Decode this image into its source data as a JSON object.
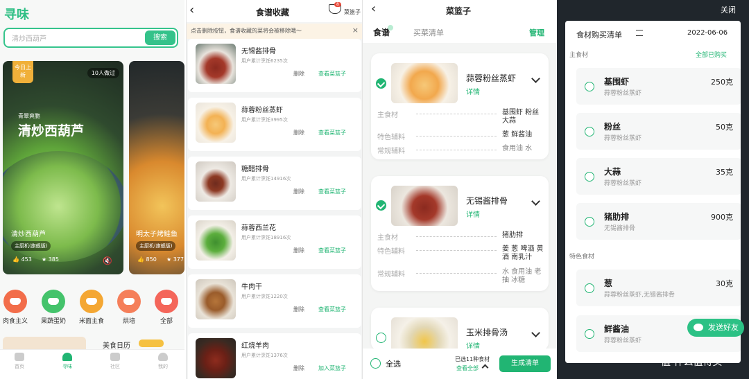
{
  "screen1": {
    "logo": "寻味",
    "search_placeholder": "清炒西葫芦",
    "search_button": "搜索",
    "card1": {
      "tag": "今日上新",
      "viewed": "10人做过",
      "subtitle": "青翠爽脆",
      "title": "清炒西葫芦",
      "caption": "清炒西葫芦",
      "machine": "主厨机(旗舰版)",
      "likes": "453",
      "favs": "385",
      "mute_icon": "mute-icon"
    },
    "card2": {
      "caption": "明太子烤鲑鱼",
      "machine": "主厨机(旗舰版)",
      "likes": "850",
      "favs": "377"
    },
    "categories": [
      {
        "label": "肉食主义",
        "color": "#f26d4a"
      },
      {
        "label": "果蔬蛋奶",
        "color": "#44c36b"
      },
      {
        "label": "米面主食",
        "color": "#f4a733"
      },
      {
        "label": "烘培",
        "color": "#f57f5a"
      },
      {
        "label": "全部",
        "color": "#f4665a"
      }
    ],
    "promo_text": "美食日历",
    "promo_badge": "",
    "tabs": [
      "首页",
      "寻味",
      "社区",
      "我的"
    ]
  },
  "screen2": {
    "title": "食谱收藏",
    "basket_label": "菜篮子",
    "basket_count": "8",
    "notice": "点击删除按钮，食谱收藏的菜将会被移除哦～",
    "close": "×",
    "delete_label": "删除",
    "recipes": [
      {
        "name": "无锡酱排骨",
        "count": "用户累计烹饪6235次",
        "action": "查看菜篮子"
      },
      {
        "name": "蒜蓉粉丝蒸虾",
        "count": "用户累计烹饪3995次",
        "action": "查看菜篮子"
      },
      {
        "name": "糖醋排骨",
        "count": "用户累计烹饪14916次",
        "action": "查看菜篮子"
      },
      {
        "name": "蒜蓉西兰花",
        "count": "用户累计烹饪18916次",
        "action": "查看菜篮子"
      },
      {
        "name": "牛肉干",
        "count": "用户累计烹饪1220次",
        "action": "查看菜篮子"
      },
      {
        "name": "红烧羊肉",
        "count": "用户累计烹饪1376次",
        "action": "加入菜篮子"
      }
    ]
  },
  "screen3": {
    "title": "菜篮子",
    "tab_recipes": "食谱",
    "tab_list": "买菜清单",
    "manage": "管理",
    "details_label": "详情",
    "labels": {
      "main": "主食材",
      "special": "特色辅料",
      "common": "常规辅料"
    },
    "recipes": [
      {
        "name": "蒜蓉粉丝蒸虾",
        "main": "基围虾 粉丝 大蒜",
        "special": "葱 鲜酱油",
        "common": "食用油 水"
      },
      {
        "name": "无锡酱排骨",
        "main": "猪肋排",
        "special": "姜 葱 啤酒 黄酒 南乳汁",
        "common": "水 食用油 老抽 冰糖"
      },
      {
        "name": "玉米排骨汤",
        "main": "",
        "special": "",
        "common": ""
      }
    ],
    "select_all": "全选",
    "selected": "已选11种食材",
    "view_all": "查看全部",
    "generate": "生成清单"
  },
  "screen4": {
    "close": "关闭",
    "list_title": "食材购买清单",
    "date": "2022-06-06",
    "section_main": "主食材",
    "all_bought": "全部已购买",
    "section_special": "特色食材",
    "items": [
      {
        "name": "基围虾",
        "source": "蒜蓉粉丝蒸虾",
        "qty": "250克"
      },
      {
        "name": "粉丝",
        "source": "蒜蓉粉丝蒸虾",
        "qty": "50克"
      },
      {
        "name": "大蒜",
        "source": "蒜蓉粉丝蒸虾",
        "qty": "35克"
      },
      {
        "name": "猪肋排",
        "source": "无锡酱排骨",
        "qty": "900克"
      },
      {
        "name": "葱",
        "source": "蒜蓉粉丝蒸虾,无锡酱排骨",
        "qty": "30克"
      },
      {
        "name": "鲜酱油",
        "source": "蒜蓉粉丝蒸虾",
        "qty": ""
      }
    ],
    "share": "发送好友",
    "watermark": "值 什么值得买"
  }
}
